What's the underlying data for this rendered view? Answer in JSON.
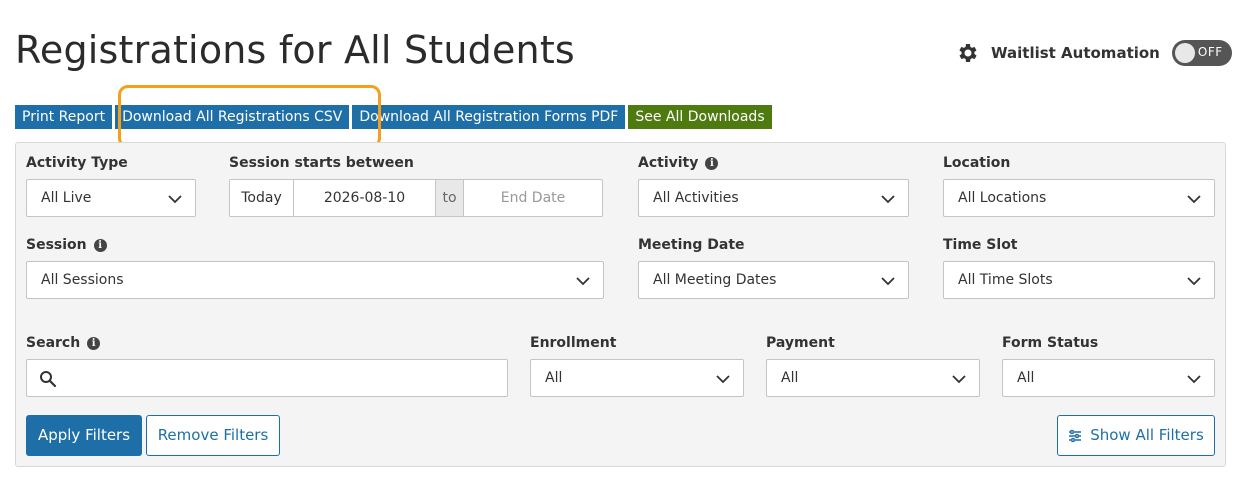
{
  "page": {
    "title": "Registrations for All Students"
  },
  "waitlist": {
    "label": "Waitlist Automation",
    "toggle_text": "OFF",
    "icon": "gear-icon"
  },
  "toolbar": {
    "print": "Print Report",
    "download_csv": "Download All Registrations CSV",
    "download_pdf": "Download All Registration Forms PDF",
    "see_downloads": "See All Downloads"
  },
  "filters": {
    "activity_type": {
      "label": "Activity Type",
      "value": "All Live"
    },
    "session_starts": {
      "label": "Session starts between",
      "today": "Today",
      "start_date": "2026-08-10",
      "to": "to",
      "end_placeholder": "End Date"
    },
    "activity": {
      "label": "Activity",
      "value": "All Activities"
    },
    "location": {
      "label": "Location",
      "value": "All Locations"
    },
    "session": {
      "label": "Session",
      "value": "All Sessions"
    },
    "meeting_date": {
      "label": "Meeting Date",
      "value": "All Meeting Dates"
    },
    "time_slot": {
      "label": "Time Slot",
      "value": "All Time Slots"
    },
    "search": {
      "label": "Search",
      "placeholder": ""
    },
    "enrollment": {
      "label": "Enrollment",
      "value": "All"
    },
    "payment": {
      "label": "Payment",
      "value": "All"
    },
    "form_status": {
      "label": "Form Status",
      "value": "All"
    }
  },
  "actions": {
    "apply": "Apply Filters",
    "remove": "Remove Filters",
    "show_all": "Show All Filters"
  },
  "colors": {
    "primary": "#1e6fa8",
    "green": "#4e7a10",
    "highlight": "#f5a01a"
  }
}
